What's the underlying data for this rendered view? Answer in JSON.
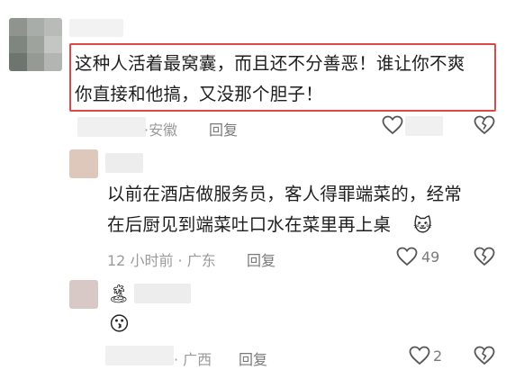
{
  "comments": [
    {
      "text_lines": [
        "这种人活着最窝囊，而且还不分善恶！谁让你不爽",
        "你直接和他搞，又没那个胆子！"
      ],
      "location": "·安徽",
      "reply_label": "回复",
      "like_count": ""
    },
    {
      "text_lines": [
        "以前在酒店做服务员，客人得罪端菜的，经常",
        "在后厨见到端菜吐口水在菜里再上桌"
      ],
      "inline_emoji": "🐱",
      "time_location": "12 小时前 · 广东",
      "reply_label": "回复",
      "like_count": "49"
    },
    {
      "name_emoji": "🏝",
      "text_emoji": "😗",
      "location": "· 广西",
      "reply_label": "回复",
      "like_count": "2"
    }
  ],
  "icons": {
    "like": "heart-outline-icon",
    "dislike": "broken-heart-icon"
  },
  "colors": {
    "highlight_border": "#e04848",
    "meta_text": "#9a9a9a",
    "body_text": "#1e1e1e"
  }
}
